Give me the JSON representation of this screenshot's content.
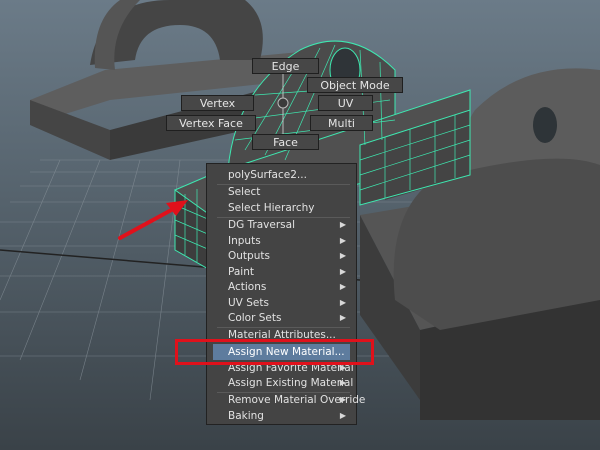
{
  "marking_menu": {
    "edge": "Edge",
    "object_mode": "Object Mode",
    "vertex": "Vertex",
    "uv": "UV",
    "vertex_face": "Vertex Face",
    "multi": "Multi",
    "face": "Face"
  },
  "context_menu": {
    "title": "polySurface2...",
    "items": [
      {
        "label": "Select",
        "submenu": false
      },
      {
        "label": "Select Hierarchy",
        "submenu": false
      },
      {
        "label": "DG Traversal",
        "submenu": true
      },
      {
        "label": "Inputs",
        "submenu": true
      },
      {
        "label": "Outputs",
        "submenu": true
      },
      {
        "label": "Paint",
        "submenu": true
      },
      {
        "label": "Actions",
        "submenu": true
      },
      {
        "label": "UV Sets",
        "submenu": true
      },
      {
        "label": "Color Sets",
        "submenu": true
      },
      {
        "label": "Material Attributes...",
        "submenu": false
      },
      {
        "label": "Assign New Material...",
        "submenu": false,
        "highlighted": true
      },
      {
        "label": "Assign Favorite Material",
        "submenu": true
      },
      {
        "label": "Assign Existing Material",
        "submenu": true
      },
      {
        "label": "Remove Material Override",
        "submenu": true
      },
      {
        "label": "Baking",
        "submenu": true
      }
    ]
  },
  "colors": {
    "wireframe": "#3ee8b0",
    "highlight": "#5e7c9e",
    "annotation": "#e0111b"
  },
  "annotation": {
    "arrow": "red-arrow",
    "box": "red-highlight-box"
  }
}
